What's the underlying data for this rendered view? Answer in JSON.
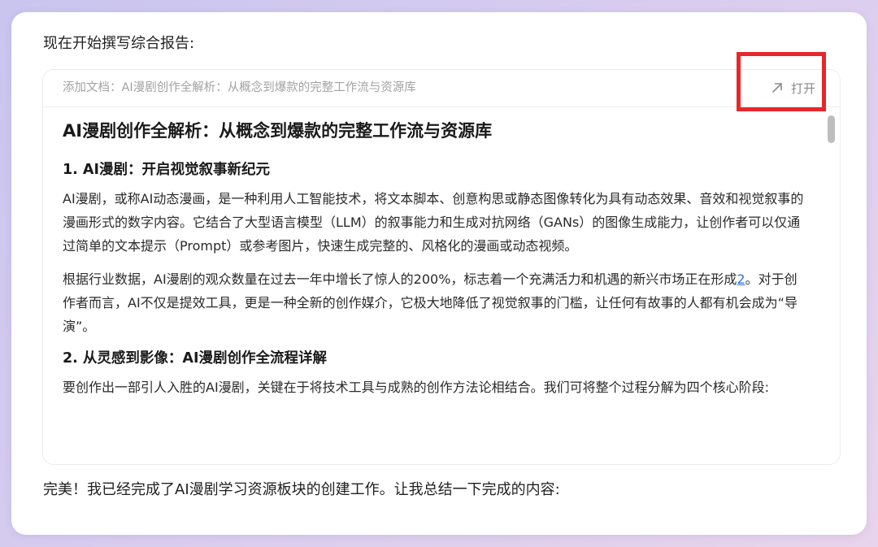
{
  "message": {
    "intro": "现在开始撰写综合报告:",
    "outro": "完美！我已经完成了AI漫剧学习资源板块的创建工作。让我总结一下完成的内容:"
  },
  "document": {
    "header_title": "添加文档：AI漫剧创作全解析：从概念到爆款的完整工作流与资源库",
    "open_label": "打开",
    "open_icon": "arrow-up-right-icon",
    "title": "AI漫剧创作全解析：从概念到爆款的完整工作流与资源库",
    "sections": [
      {
        "heading": "1. AI漫剧：开启视觉叙事新纪元",
        "p1": "AI漫剧，或称AI动态漫画，是一种利用人工智能技术，将文本脚本、创意构思或静态图像转化为具有动态效果、音效和视觉叙事的漫画形式的数字内容。它结合了大型语言模型（LLM）的叙事能力和生成对抗网络（GANs）的图像生成能力，让创作者可以仅通过简单的文本提示（Prompt）或参考图片，快速生成完整的、风格化的漫画或动态视频。",
        "p2_before": "根据行业数据，AI漫剧的观众数量在过去一年中增长了惊人的200%，标志着一个充满活力和机遇的新兴市场正在形成",
        "p2_ref": "2",
        "p2_after": "。对于创作者而言，AI不仅是提效工具，更是一种全新的创作媒介，它极大地降低了视觉叙事的门槛，让任何有故事的人都有机会成为“导演”。"
      },
      {
        "heading": "2. 从灵感到影像：AI漫剧创作全流程详解",
        "p1": "要创作出一部引人入胜的AI漫剧，关键在于将技术工具与成熟的创作方法论相结合。我们可将整个过程分解为四个核心阶段:"
      }
    ]
  },
  "colors": {
    "highlight": "#e8262b",
    "link": "#2f6fd6",
    "background_start": "#c9c5ef",
    "background_end": "#e8d4ec"
  }
}
